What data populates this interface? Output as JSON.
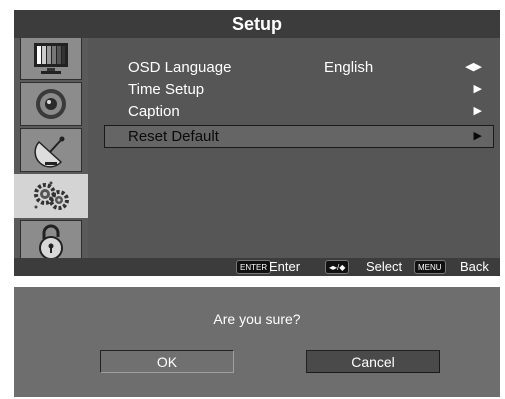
{
  "header": {
    "title": "Setup"
  },
  "sidebar": {
    "tabs": [
      {
        "icon": "picture-icon",
        "active": false
      },
      {
        "icon": "sound-icon",
        "active": false
      },
      {
        "icon": "channel-icon",
        "active": false
      },
      {
        "icon": "setup-gears-icon",
        "active": true
      },
      {
        "icon": "lock-icon",
        "active": false
      }
    ]
  },
  "menu": {
    "items": [
      {
        "label": "OSD Language",
        "value": "English",
        "arrows": "◀▶"
      },
      {
        "label": "Time Setup",
        "value": "",
        "arrows": "▶"
      },
      {
        "label": "Caption",
        "value": "",
        "arrows": "▶"
      },
      {
        "label": "Reset Default",
        "value": "",
        "arrows": "▶",
        "selected": true
      }
    ]
  },
  "footer": {
    "enter_key": "ENTER",
    "enter_label": "Enter",
    "select_key": "◂▸/◆",
    "select_label": "Select",
    "menu_key": "MENU",
    "menu_label": "Back"
  },
  "dialog": {
    "message": "Are you sure?",
    "ok_label": "OK",
    "cancel_label": "Cancel"
  }
}
